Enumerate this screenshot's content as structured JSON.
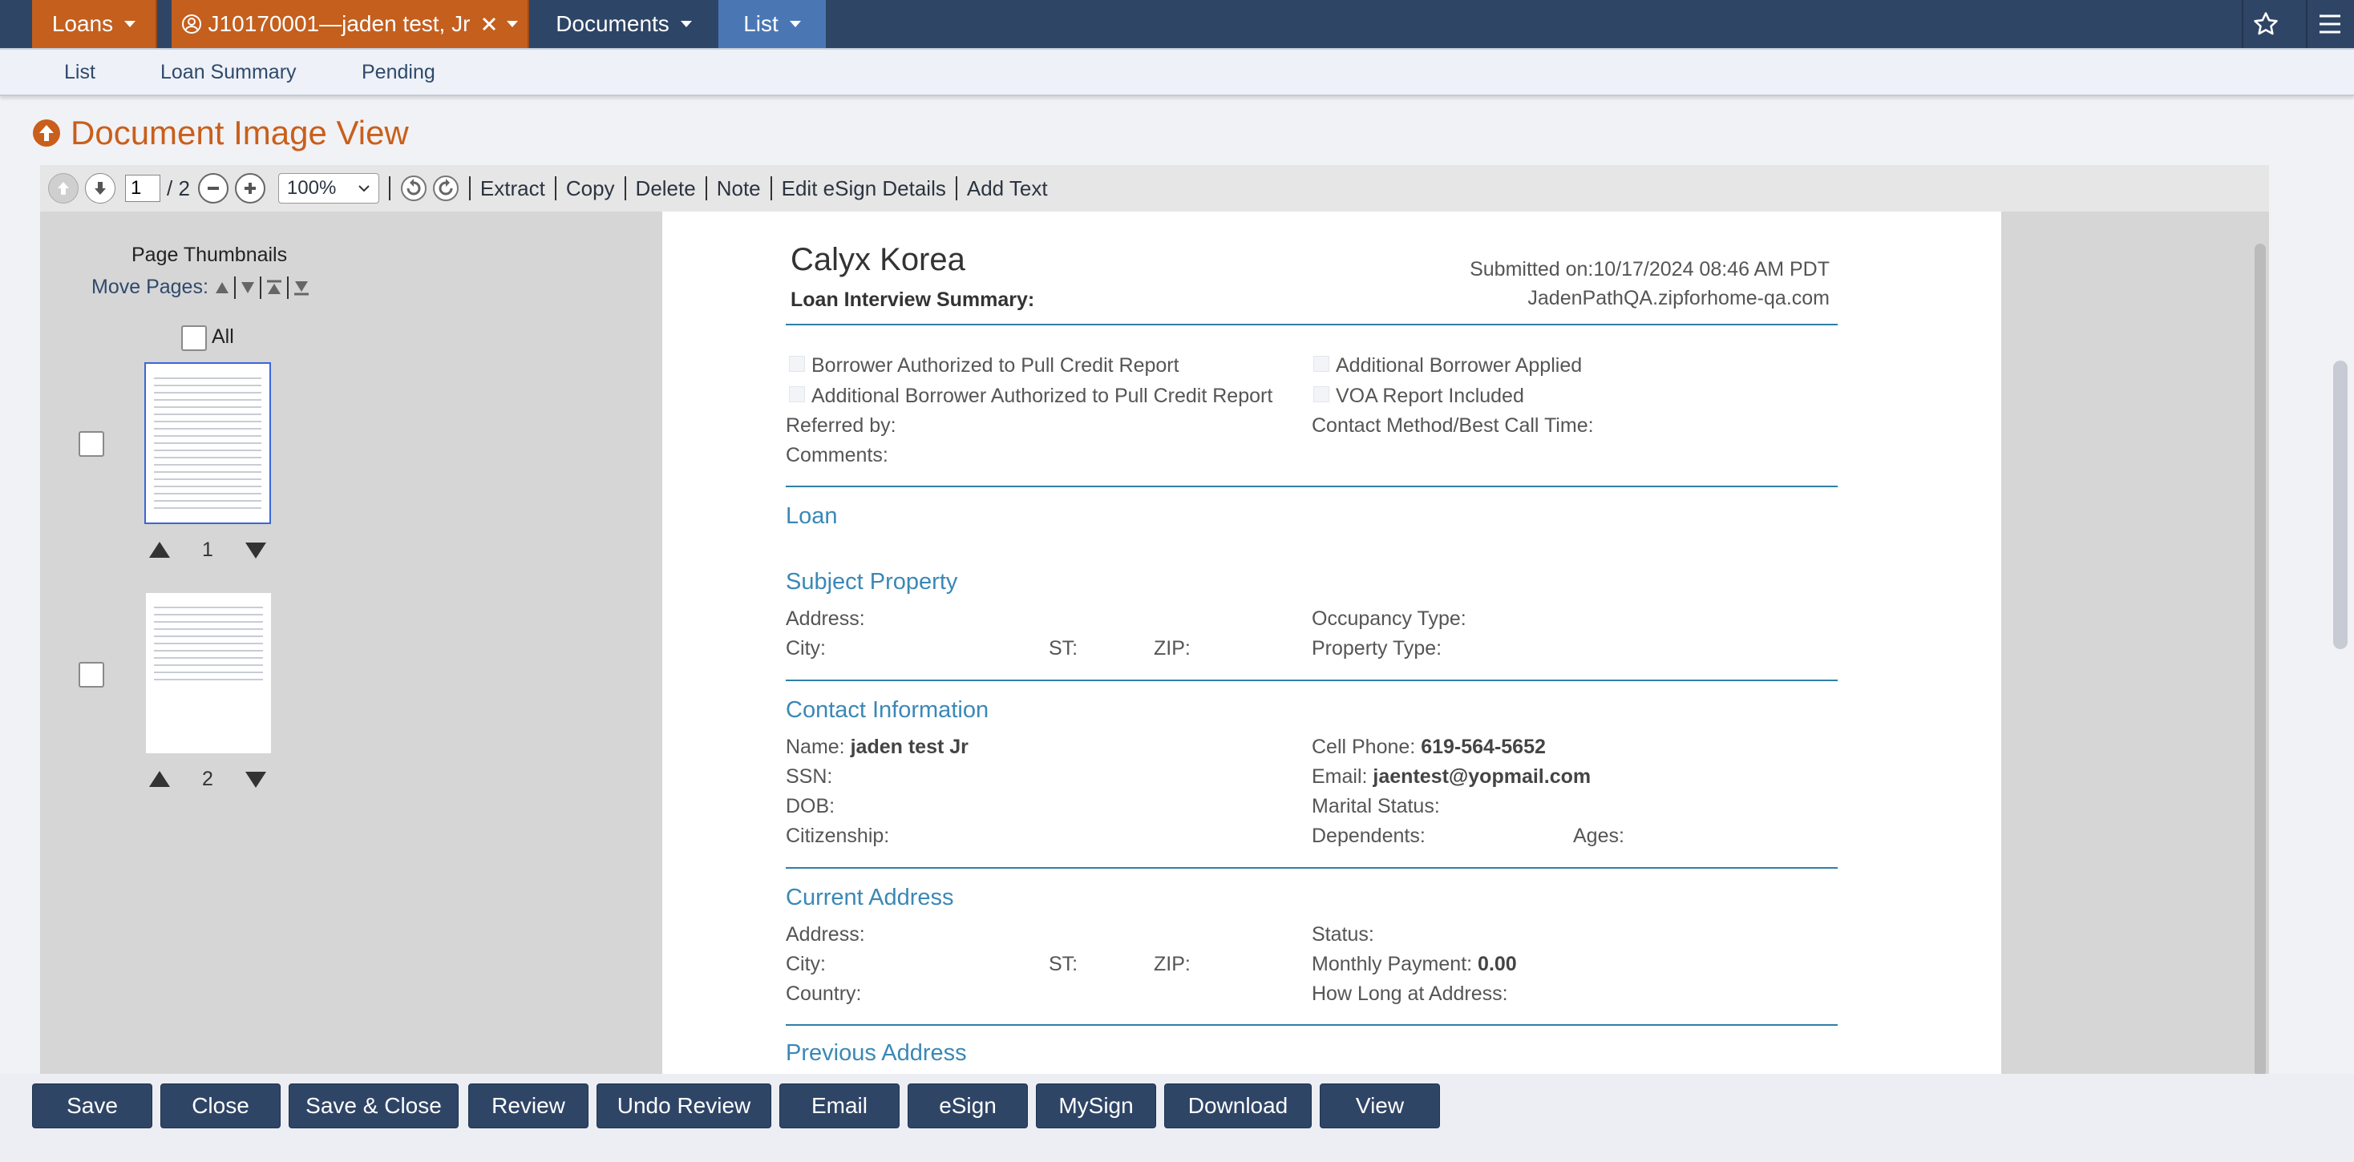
{
  "topbar": {
    "tabs": [
      {
        "label": "Loans"
      },
      {
        "label": "J10170001—jaden test, Jr"
      },
      {
        "label": "Documents"
      },
      {
        "label": "List"
      }
    ],
    "star_icon": "star-icon",
    "menu_icon": "hamburger-menu-icon"
  },
  "subnav": {
    "items": [
      "List",
      "Loan Summary",
      "Pending"
    ]
  },
  "page_title": "Document Image View",
  "toolbar": {
    "page_current": "1",
    "page_total": "/ 2",
    "zoom": "100%",
    "links": [
      "Extract",
      "Copy",
      "Delete",
      "Note",
      "Edit eSign Details",
      "Add Text"
    ]
  },
  "thumbnails": {
    "title": "Page Thumbnails",
    "move_pages_label": "Move Pages:",
    "all_label": "All",
    "pages": [
      "1",
      "2"
    ]
  },
  "document": {
    "company": "Calyx Korea",
    "summary_title": "Loan Interview Summary:",
    "submitted": "Submitted on:10/17/2024 08:46 AM PDT",
    "site": "JadenPathQA.zipforhome-qa.com",
    "checks": [
      "Borrower Authorized to Pull Credit Report",
      "Additional Borrower Applied",
      "Additional Borrower Authorized to Pull Credit Report",
      "VOA Report Included"
    ],
    "referred_by": "Referred by:",
    "contact_method": "Contact Method/Best Call Time:",
    "comments": "Comments:",
    "section_loan": "Loan",
    "section_subject": "Subject Property",
    "address_label": "Address:",
    "occupancy": "Occupancy Type:",
    "city_label": "City:",
    "st_label": "ST:",
    "zip_label": "ZIP:",
    "property_type": "Property Type:",
    "section_contact": "Contact Information",
    "name_label": "Name:",
    "name_value": "jaden test Jr",
    "cell_label": "Cell Phone:",
    "cell_value": "619-564-5652",
    "ssn_label": "SSN:",
    "email_label": "Email:",
    "email_value": "jaentest@yopmail.com",
    "dob_label": "DOB:",
    "marital_label": "Marital Status:",
    "citizenship_label": "Citizenship:",
    "dependents_label": "Dependents:",
    "ages_label": "Ages:",
    "section_current": "Current Address",
    "status_label": "Status:",
    "monthly_label": "Monthly Payment:",
    "monthly_value": "0.00",
    "country_label": "Country:",
    "howlong_label": "How Long at Address:",
    "section_previous": "Previous Address"
  },
  "buttons": [
    "Save",
    "Close",
    "Save & Close",
    "Review",
    "Undo Review",
    "Email",
    "eSign",
    "MySign",
    "Download",
    "View"
  ],
  "colors": {
    "nav": "#2f4566",
    "orange_tab": "#c45f1e",
    "active_tab": "#4a77b4",
    "title": "#c95f1b",
    "section": "#3a88b6"
  }
}
